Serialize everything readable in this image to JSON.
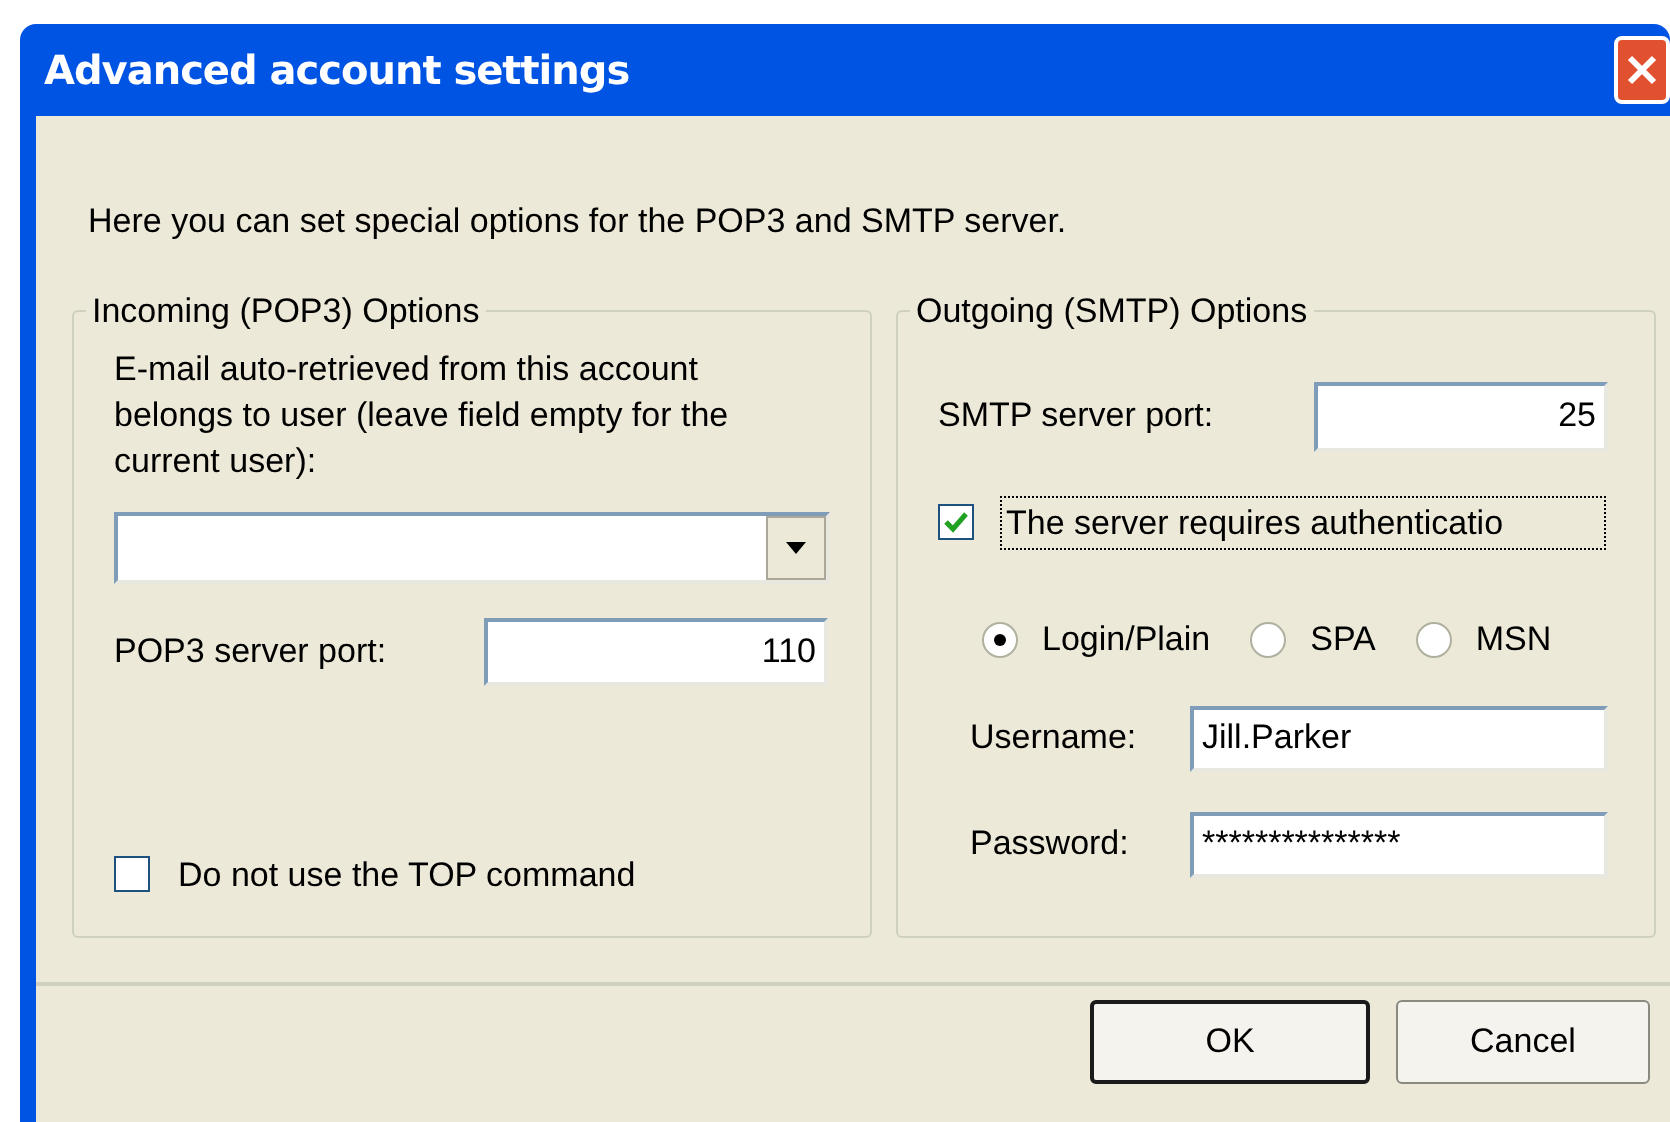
{
  "window": {
    "title": "Advanced account settings"
  },
  "intro": "Here you can set special options for the POP3 and SMTP server.",
  "incoming": {
    "title": "Incoming (POP3) Options",
    "user_label": "E-mail auto-retrieved from this account belongs to user (leave field empty for the current user):",
    "pop3_port": {
      "label": "POP3 server port:",
      "value": "110"
    },
    "no_top": {
      "label": "Do not use the TOP command",
      "checked": false
    }
  },
  "outgoing": {
    "title": "Outgoing (SMTP) Options",
    "smtp_port": {
      "label": "SMTP server port:",
      "value": "25"
    },
    "auth": {
      "label": "The server requires authenticatio",
      "checked": true
    },
    "auth_methods": [
      {
        "label": "Login/Plain",
        "selected": true
      },
      {
        "label": "SPA",
        "selected": false
      },
      {
        "label": "MSN",
        "selected": false
      }
    ],
    "username": {
      "label": "Username:",
      "value": "Jill.Parker"
    },
    "password": {
      "label": "Password:",
      "value": "***************"
    }
  },
  "buttons": [
    {
      "label": "OK",
      "default": true
    },
    {
      "label": "Cancel",
      "default": false
    }
  ]
}
